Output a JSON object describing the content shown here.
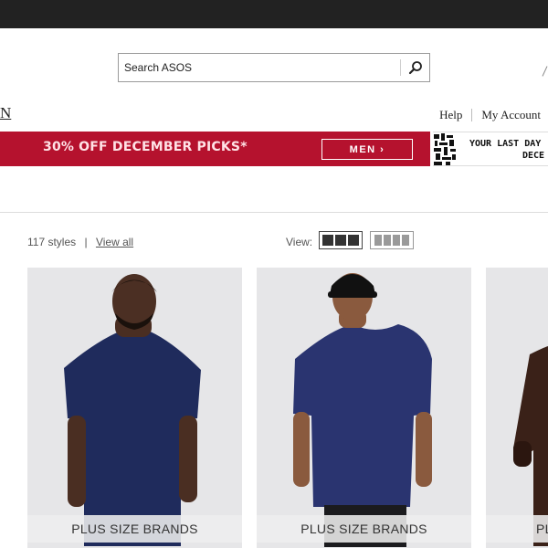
{
  "search": {
    "placeholder": "Search ASOS"
  },
  "header": {
    "logo_fragment": "N",
    "links": [
      "Help",
      "My Account"
    ]
  },
  "promo": {
    "text": "30% OFF DECEMBER PICKS*",
    "button_label": "MEN ›",
    "color": "#b5122e"
  },
  "promo2": {
    "line1": "YOUR LAST DAY",
    "line2": "DECE"
  },
  "listing": {
    "count_text": "117 styles",
    "separator": "|",
    "view_all": "View all",
    "view_label": "View:"
  },
  "products": [
    {
      "label": "PLUS SIZE BRANDS",
      "shirt_color": "#1f2b5c"
    },
    {
      "label": "PLUS SIZE BRANDS",
      "shirt_color": "#2a3470"
    },
    {
      "label": "PLUS SIZE BRANDS",
      "shirt_color": "#3a2118"
    }
  ],
  "icons": [
    "search-icon",
    "grid-three-icon",
    "grid-four-icon"
  ]
}
